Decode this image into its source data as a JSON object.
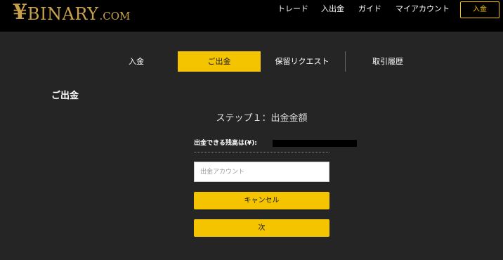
{
  "header": {
    "logo": {
      "symbol": "¥",
      "word": "BINARY",
      "suffix": ".COM"
    },
    "nav": [
      "トレード",
      "入出金",
      "ガイド",
      "マイアカウント"
    ],
    "cta_label": "入金"
  },
  "tabs": [
    {
      "label": "入金",
      "active": false
    },
    {
      "label": "ご出金",
      "active": true
    },
    {
      "label": "保留リクエスト",
      "active": false
    },
    {
      "label": "取引履歴",
      "active": false
    }
  ],
  "main": {
    "page_title": "ご出金",
    "step_title": "ステップ１：出金金額",
    "balance_label": "出金できる残高は(¥):",
    "account_placeholder": "出金アカウント",
    "account_value": "",
    "cancel_label": "キャンセル",
    "next_label": "次"
  },
  "colors": {
    "accent": "#f5c400",
    "header_bg": "#000000",
    "page_bg": "#252525",
    "logo_gold": "#c9a14a"
  }
}
